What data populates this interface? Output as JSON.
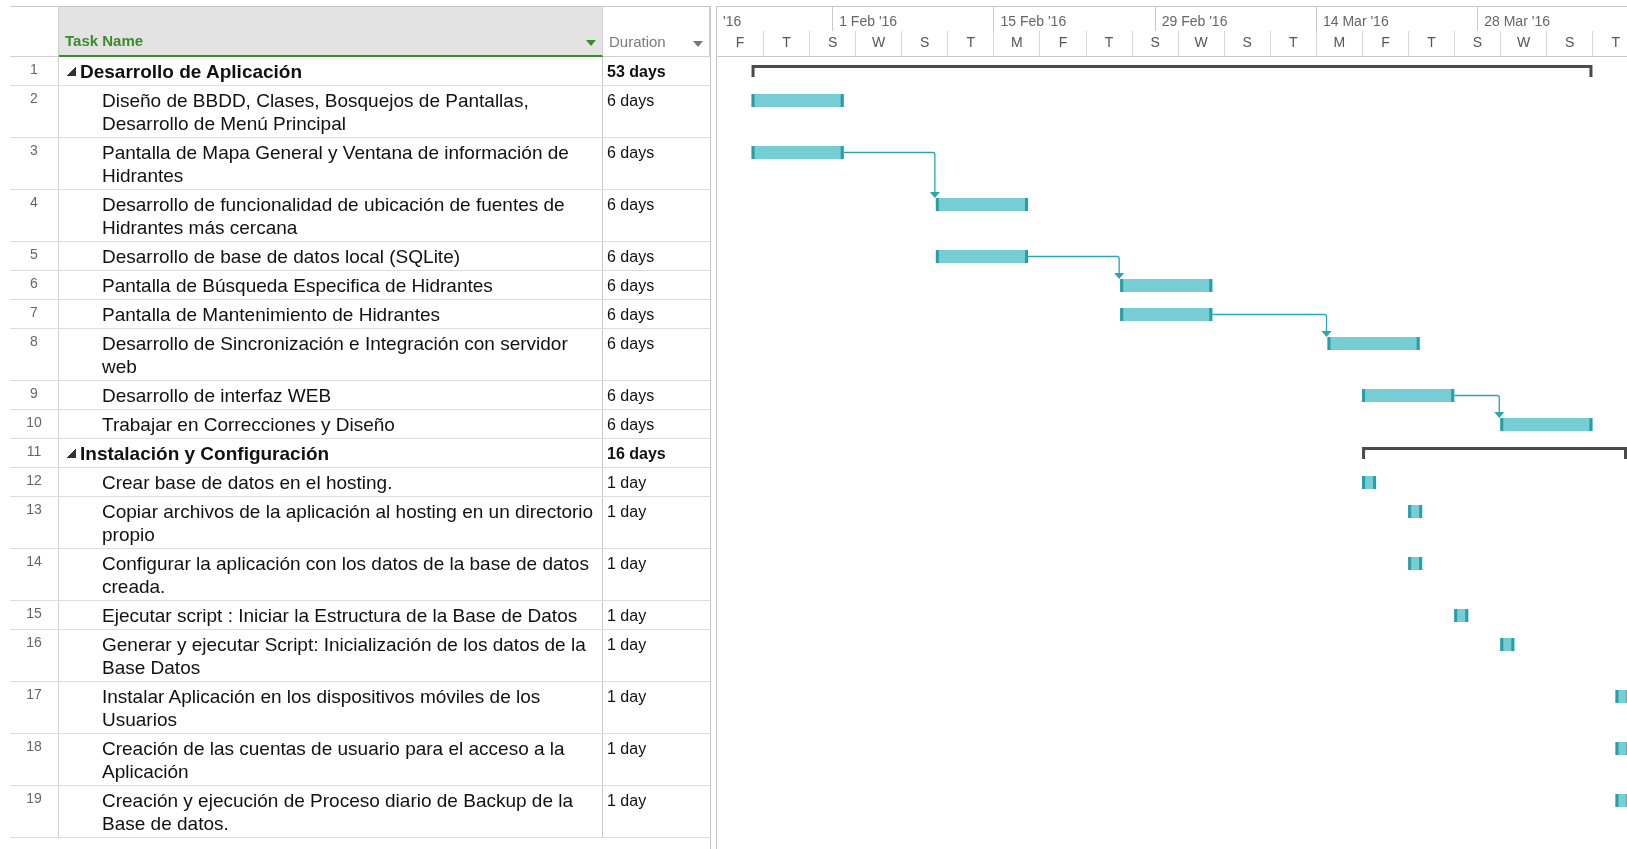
{
  "columns": [
    {
      "label": "Task Name",
      "selected": true
    },
    {
      "label": "Duration",
      "selected": false
    }
  ],
  "timescale": {
    "major": [
      "'16",
      "1 Feb '16",
      "15 Feb '16",
      "29 Feb '16",
      "14 Mar '16",
      "28 Mar '16"
    ],
    "minor": [
      "F",
      "T",
      "S",
      "W",
      "S",
      "T",
      "M",
      "F",
      "T",
      "S",
      "W",
      "S",
      "T",
      "M",
      "F",
      "T",
      "S",
      "W",
      "S",
      "T"
    ]
  },
  "tasks": [
    {
      "id": "1",
      "name": "Desarrollo de Aplicación",
      "duration": "53 days",
      "expanded": true,
      "children": [
        {
          "id": "2",
          "name": "Diseño de BBDD, Clases, Bosquejos de Pantallas, Desarrollo de Menú Principal",
          "duration": "6 days"
        },
        {
          "id": "3",
          "name": "Pantalla de Mapa General y Ventana de información de Hidrantes",
          "duration": "6 days",
          "link_to_next": true
        },
        {
          "id": "4",
          "name": "Desarrollo de funcionalidad de ubicación de fuentes de Hidrantes más cercana",
          "duration": "6 days"
        },
        {
          "id": "5",
          "name": "Desarrollo de base de datos local (SQLite)",
          "duration": "6 days",
          "link_to_next": true
        },
        {
          "id": "6",
          "name": "Pantalla de Búsqueda Especifica de Hidrantes",
          "duration": "6 days"
        },
        {
          "id": "7",
          "name": "Pantalla de Mantenimiento de Hidrantes",
          "duration": "6 days",
          "link_to_next": true
        },
        {
          "id": "8",
          "name": "Desarrollo de Sincronización e Integración con servidor web",
          "duration": "6 days"
        },
        {
          "id": "9",
          "name": "Desarrollo de interfaz WEB",
          "duration": "6 days",
          "link_to_next": true
        },
        {
          "id": "10",
          "name": "Trabajar en Correcciones y Diseño",
          "duration": "6 days"
        }
      ]
    },
    {
      "id": "11",
      "name": "Instalación y Configuración",
      "duration": "16 days",
      "expanded": true,
      "children": [
        {
          "id": "12",
          "name": "Crear base de datos en el hosting.",
          "duration": "1 day"
        },
        {
          "id": "13",
          "name": "Copiar archivos de la aplicación al hosting en un directorio propio",
          "duration": "1 day"
        },
        {
          "id": "14",
          "name": "Configurar la aplicación con los datos de la base de datos creada.",
          "duration": "1 day"
        },
        {
          "id": "15",
          "name": "Ejecutar script : Iniciar la Estructura de la Base de Datos",
          "duration": "1 day"
        },
        {
          "id": "16",
          "name": "Generar y ejecutar Script: Inicialización de los datos de la Base Datos",
          "duration": "1 day"
        },
        {
          "id": "17",
          "name": "Instalar Aplicación en los dispositivos móviles de los Usuarios",
          "duration": "1 day"
        },
        {
          "id": "18",
          "name": "Creación de las cuentas de usuario para el acceso a la Aplicación",
          "duration": "1 day"
        },
        {
          "id": "19",
          "name": "Creación y ejecución de Proceso diario de Backup de la Base de datos.",
          "duration": "1 day"
        }
      ]
    }
  ]
}
